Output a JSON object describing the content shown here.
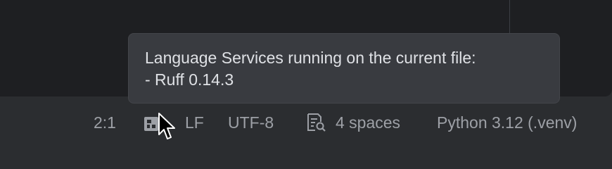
{
  "tooltip": {
    "line1": "Language Services running on the current file:",
    "line2": "- Ruff 0.14.3"
  },
  "status_bar": {
    "position": "2:1",
    "line_separator": "LF",
    "encoding": "UTF-8",
    "indent": "4 spaces",
    "interpreter": "Python 3.12 (.venv)"
  },
  "icons": {
    "language_services": "language-services-icon",
    "indent": "document-search-icon",
    "cursor": "mouse-pointer-icon"
  },
  "colors": {
    "editor_bg": "#1e1f22",
    "statusbar_bg": "#2b2d30",
    "tooltip_bg": "#393b40",
    "tooltip_text": "#dfe1e5",
    "statusbar_text": "#9da0a6"
  }
}
